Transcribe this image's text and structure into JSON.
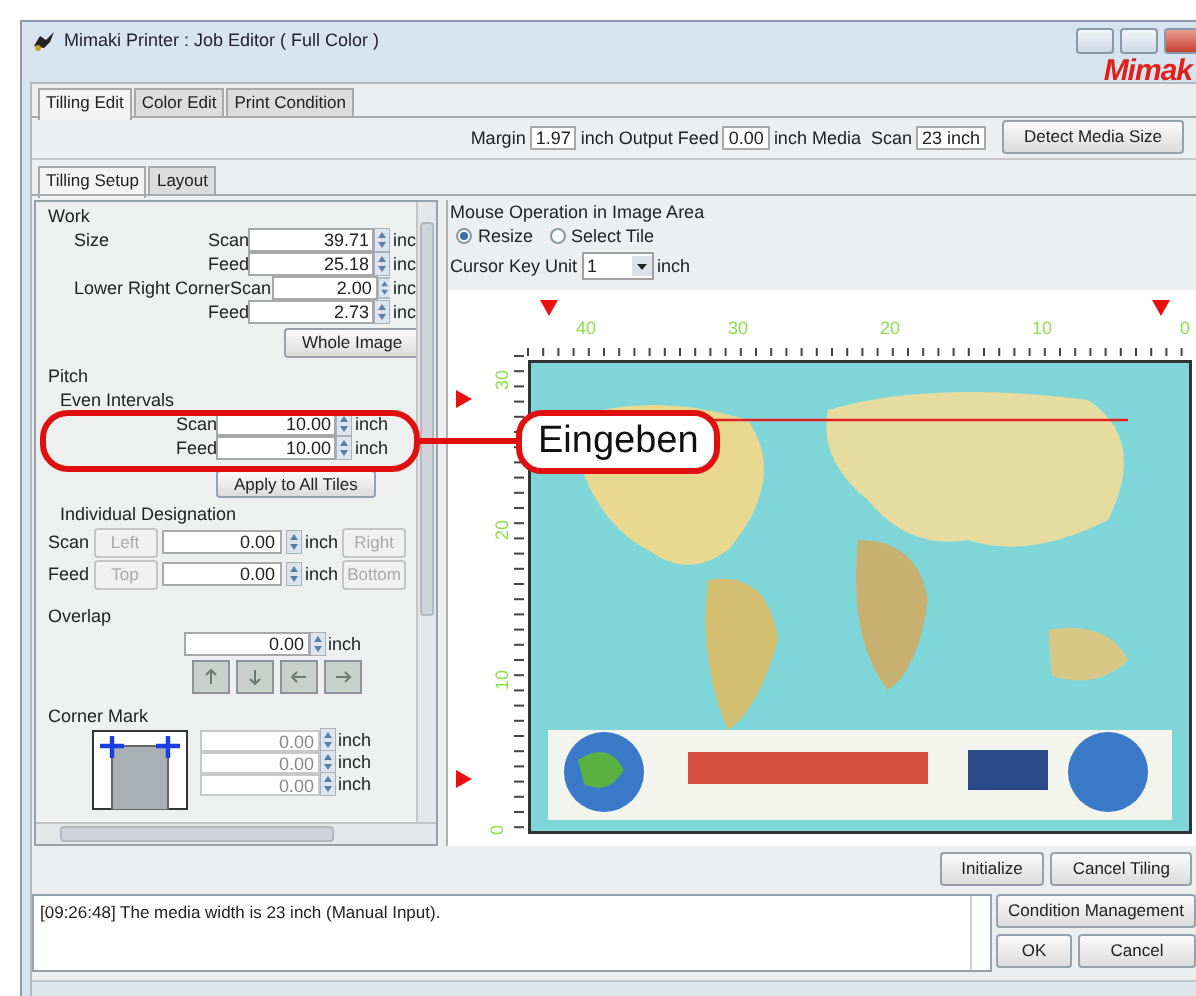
{
  "window": {
    "title": "Mimaki Printer : Job Editor ( Full Color )",
    "logo": "Mimak"
  },
  "tabs": [
    {
      "label": "Tilling Edit",
      "selected": true
    },
    {
      "label": "Color Edit",
      "selected": false
    },
    {
      "label": "Print Condition",
      "selected": false
    }
  ],
  "toolbar": [
    {
      "kind": "label",
      "text": "Margin"
    },
    {
      "kind": "field",
      "text": "1.97"
    },
    {
      "kind": "label",
      "text": "inch Output Feed"
    },
    {
      "kind": "field",
      "text": "0.00"
    },
    {
      "kind": "label",
      "text": "inch Media  Scan"
    },
    {
      "kind": "field",
      "text": "23 inch"
    },
    {
      "kind": "button",
      "text": "Detect Media Size"
    }
  ],
  "subtabs": [
    {
      "label": "Tilling Setup",
      "selected": true
    },
    {
      "label": "Layout",
      "selected": false
    }
  ],
  "work": {
    "title": "Work",
    "rows": [
      {
        "group": "Size",
        "axis": "Scan",
        "value": "39.71",
        "unit": "inc"
      },
      {
        "axis": "Feed",
        "value": "25.18",
        "unit": "inc"
      },
      {
        "group": "Lower Right Corner",
        "axis": "Scan",
        "value": "2.00",
        "unit": "inc"
      },
      {
        "axis": "Feed",
        "value": "2.73",
        "unit": "inc"
      }
    ],
    "button": "Whole Image"
  },
  "pitch": {
    "title": "Pitch",
    "subtitle": "Even Intervals",
    "rows": [
      {
        "axis": "Scan",
        "value": "10.00",
        "unit": "inch"
      },
      {
        "axis": "Feed",
        "value": "10.00",
        "unit": "inch"
      }
    ],
    "button": "Apply to All Tiles"
  },
  "individual": {
    "title": "Individual Designation",
    "rows": [
      {
        "axis": "Scan",
        "first": "Left",
        "value": "0.00",
        "unit": "inch",
        "second": "Right",
        "disabled": true
      },
      {
        "axis": "Feed",
        "first": "Top",
        "value": "0.00",
        "unit": "inch",
        "second": "Bottom",
        "disabled": true
      }
    ]
  },
  "overlap": {
    "title": "Overlap",
    "value": "0.00",
    "unit": "inch"
  },
  "corner_mark": {
    "title": "Corner Mark",
    "fields": [
      {
        "value": "0.00",
        "unit": "inch",
        "disabled": true
      },
      {
        "value": "0.00",
        "unit": "inch",
        "disabled": true
      },
      {
        "value": "0.00",
        "unit": "inch",
        "disabled": true
      }
    ]
  },
  "mouse_operation": {
    "title": "Mouse Operation in Image Area",
    "options": [
      {
        "label": "Resize",
        "selected": true
      },
      {
        "label": "Select Tile",
        "selected": false
      }
    ],
    "cursor_key_label": "Cursor Key Unit",
    "cursor_key_value": "1",
    "cursor_key_unit": "inch"
  },
  "canvas": {
    "x_ticks": [
      "40",
      "30",
      "20",
      "10",
      "0"
    ],
    "y_ticks": [
      "30",
      "20",
      "10",
      "0"
    ],
    "image": {
      "kind": "picture"
    }
  },
  "actions": [
    "Initialize",
    "Cancel Tiling"
  ],
  "log": {
    "lines": [
      "[09:26:48] The media width is 23 inch (Manual Input)."
    ]
  },
  "log_buttons": [
    "Condition Management",
    "OK",
    "Cancel"
  ],
  "callout": {
    "text": "Eingeben"
  }
}
